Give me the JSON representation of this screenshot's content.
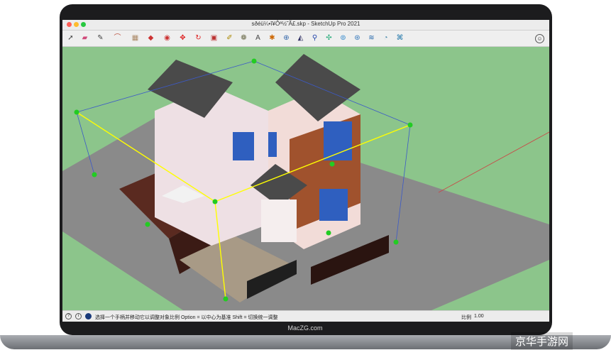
{
  "window": {
    "title": "sðéü¼•î¥Ôª½˜Ã£.skp - SketchUp Pro 2021"
  },
  "toolbar": {
    "tools": [
      "select",
      "eraser",
      "pencil",
      "arc",
      "paint",
      "push-pull",
      "follow-me",
      "move",
      "rotate",
      "scale",
      "offset",
      "tape",
      "text",
      "axes",
      "dimension",
      "protractor",
      "orbit",
      "pan",
      "zoom",
      "zoom-extents",
      "walk",
      "look-around",
      "section"
    ]
  },
  "status": {
    "message": "选择一个手柄并移动它以调整对象比例  Option = 以中心为基准  Shift = 切换统一调整",
    "scale_label": "比例",
    "scale_value": "1.00"
  },
  "laptop": {
    "brand": "MacZG.com"
  },
  "watermark": "京华手游网",
  "colors": {
    "viewport_bg": "#8cc58b",
    "ground": "#8a8a8a",
    "selection": "#ffff00"
  }
}
